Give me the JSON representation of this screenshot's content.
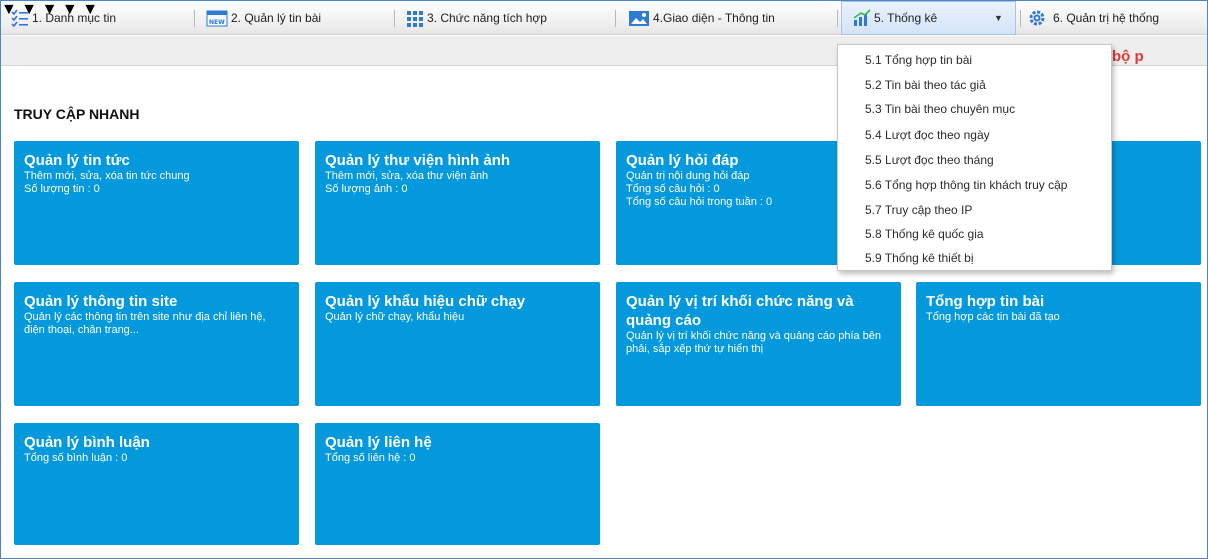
{
  "menu": {
    "items": [
      {
        "label": "1. Danh mục tin"
      },
      {
        "label": "2. Quản lý tin bài"
      },
      {
        "label": "3. Chức năng tích hợp"
      },
      {
        "label": "4.Giao diện - Thông tin"
      },
      {
        "label": "5. Thống kê"
      },
      {
        "label": "6. Quản trị hệ thống"
      }
    ],
    "new_badge": "NEW"
  },
  "marquee": "hệ với bộ p",
  "quick_access": {
    "title": "TRUY CẬP NHANH",
    "tiles": [
      {
        "title": "Quản lý tin tức",
        "lines": [
          "Thêm mới, sửa, xóa tin tức chung",
          "Số lượng tin : 0"
        ]
      },
      {
        "title": "Quản lý thư viện hình ảnh",
        "lines": [
          "Thêm mới, sửa, xóa thư viện ảnh",
          "Số lượng ảnh : 0"
        ]
      },
      {
        "title": "Quản lý hỏi đáp",
        "lines": [
          "Quản trị nội dung hỏi đáp",
          "Tổng số câu hỏi : 0",
          "Tổng số câu hỏi trong tuần : 0"
        ]
      },
      {
        "title": "Quản lý thông tin site",
        "lines": [
          "Quản lý các thông tin trên site như địa chỉ liên hệ, điện thoại, chân trang..."
        ]
      },
      {
        "title": "Quản lý khẩu hiệu chữ chạy",
        "lines": [
          "Quản lý chữ chạy, khẩu hiệu"
        ]
      },
      {
        "title": "Quản lý vị trí khối chức năng và quảng cáo",
        "lines": [
          "Quản lý vị trí khối chức năng và quảng cáo phía bên phải, sắp xếp thứ tự hiển thị"
        ]
      },
      {
        "title": "Tổng hợp tin bài",
        "lines": [
          "Tổng hợp các tin bài đã tạo"
        ]
      },
      {
        "title": "Quản lý bình luận",
        "lines": [
          "Tổng số bình luận : 0"
        ]
      },
      {
        "title": "Quản lý liên hệ",
        "lines": [
          "Tổng số liên hệ : 0"
        ]
      }
    ]
  },
  "dropdown": {
    "items": [
      "5.1 Tổng hợp tin bài",
      "5.2 Tin bài theo tác giả",
      "5.3 Tin bài theo chuyên mục",
      "5.4 Lượt đọc theo ngày",
      "5.5 Lượt đọc theo tháng",
      "5.6 Tổng hợp thông tin khách truy cập",
      "5.7 Truy cập theo IP",
      "5.8 Thống kê quốc gia",
      "5.9 Thống kê thiết bị"
    ]
  },
  "colors": {
    "tile": "#0399dc",
    "accent_red": "#e53935",
    "menu_border": "#4a86c8"
  }
}
